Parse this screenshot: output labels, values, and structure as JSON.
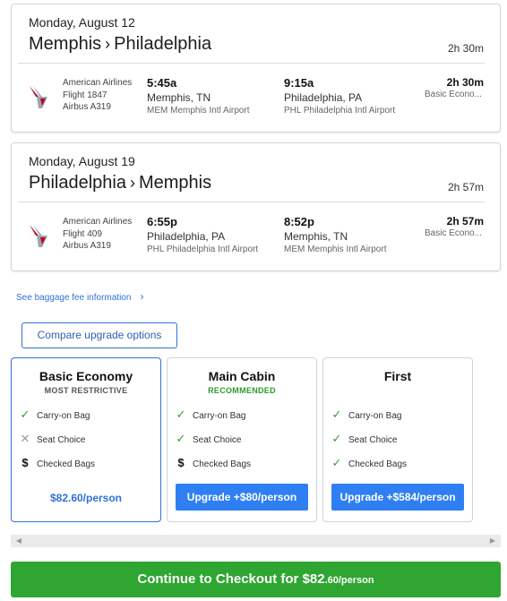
{
  "flights": [
    {
      "date": "Monday, August 12",
      "origin": "Memphis",
      "separator": "›",
      "destination": "Philadelphia",
      "duration_header": "2h 30m",
      "airline": "American Airlines",
      "flight": "Flight 1847",
      "aircraft": "Airbus A319",
      "depart_time": "5:45a",
      "depart_city": "Memphis, TN",
      "depart_airport": "MEM Memphis Intl Airport",
      "arrive_time": "9:15a",
      "arrive_city": "Philadelphia, PA",
      "arrive_airport": "PHL Philadelphia Intl Airport",
      "duration": "2h 30m",
      "fare_class": "Basic Econo..."
    },
    {
      "date": "Monday, August 19",
      "origin": "Philadelphia",
      "separator": "›",
      "destination": "Memphis",
      "duration_header": "2h 57m",
      "airline": "American Airlines",
      "flight": "Flight 409",
      "aircraft": "Airbus A319",
      "depart_time": "6:55p",
      "depart_city": "Philadelphia, PA",
      "depart_airport": "PHL Philadelphia Intl Airport",
      "arrive_time": "8:52p",
      "arrive_city": "Memphis, TN",
      "arrive_airport": "MEM Memphis Intl Airport",
      "duration": "2h 57m",
      "fare_class": "Basic Econo..."
    }
  ],
  "baggage_link": "See baggage fee information",
  "compare_button": "Compare upgrade options",
  "fares": [
    {
      "name": "Basic Economy",
      "tag": "MOST RESTRICTIVE",
      "tag_color": "#555555",
      "features": [
        {
          "icon": "check-icon",
          "label": "Carry-on Bag"
        },
        {
          "icon": "x-icon",
          "label": "Seat Choice"
        },
        {
          "icon": "dollar-icon",
          "label": "Checked Bags"
        }
      ],
      "price": "$82.60/person"
    },
    {
      "name": "Main Cabin",
      "tag": "RECOMMENDED",
      "tag_color": "#2e9a2e",
      "features": [
        {
          "icon": "check-icon",
          "label": "Carry-on Bag"
        },
        {
          "icon": "check-icon",
          "label": "Seat Choice"
        },
        {
          "icon": "dollar-icon",
          "label": "Checked Bags"
        }
      ],
      "button": "Upgrade +$80/person"
    },
    {
      "name": "First",
      "tag": "",
      "features": [
        {
          "icon": "check-icon",
          "label": "Carry-on Bag"
        },
        {
          "icon": "check-icon",
          "label": "Seat Choice"
        },
        {
          "icon": "check-icon",
          "label": "Checked Bags"
        }
      ],
      "button": "Upgrade +$584/person"
    }
  ],
  "checkout": {
    "label": "Continue to Checkout for ",
    "price_main": "$82",
    "price_small": ".60/person"
  },
  "colors": {
    "accent_blue": "#2f7ff2",
    "checkout_green": "#2fa631",
    "check_green": "#3a9a3a"
  }
}
